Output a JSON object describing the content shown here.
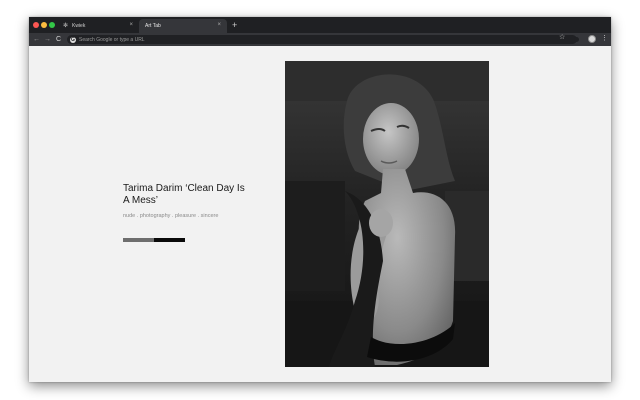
{
  "browser": {
    "tabs": [
      {
        "title": "Kwiek",
        "close_glyph": "×",
        "icon": "logo-icon"
      },
      {
        "title": "Art Tab",
        "close_glyph": "×"
      }
    ],
    "new_tab_glyph": "+",
    "nav": {
      "back": "←",
      "forward": "→",
      "reload": "C"
    },
    "omnibox": {
      "placeholder": "Search Google or type a URL",
      "value": ""
    },
    "star_glyph": "☆",
    "menu_glyph": "⋮"
  },
  "post": {
    "title": "Tarima Darim ‘Clean Day Is A Mess’",
    "tags": "nude . photography . pleasure . sincere",
    "progress": 0.5
  },
  "photo": {
    "icon": "photograph-icon"
  },
  "colors": {
    "page_background": "#f2f2f2",
    "tabstrip": "#1f2023",
    "toolbar": "#35363a",
    "progress_track": "#0a0a0a",
    "progress_fill": "#6e6e6e"
  }
}
